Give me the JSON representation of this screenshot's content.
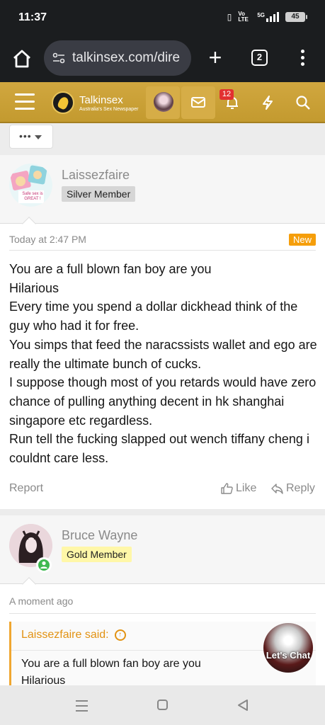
{
  "status": {
    "time": "11:37",
    "network_label": "Vo LTE",
    "signal_label": "5G",
    "battery": "45"
  },
  "browser": {
    "url": "talkinsex.com/dire",
    "tab_count": "2"
  },
  "site": {
    "name": "Talkinsex",
    "tagline": "Australia's Sex Newspaper",
    "notification_count": "12"
  },
  "posts": [
    {
      "author": "Laissezfaire",
      "role": "Silver Member",
      "avatar_caption": "Safe sex is GREAT !",
      "time": "Today at 2:47 PM",
      "new_label": "New",
      "lines": [
        "You are a full blown fan boy are you",
        "Hilarious",
        "Every time you spend a dollar dickhead think of the guy who had it for free.",
        "You simps that feed the naracssists wallet and ego are really the ultimate bunch of cucks.",
        "I suppose though most of you retards would have zero chance of pulling anything decent in hk shanghai singapore etc regardless.",
        "Run tell the fucking slapped out wench tiffany cheng i couldnt care less."
      ],
      "report_label": "Report",
      "like_label": "Like",
      "reply_label": "Reply"
    },
    {
      "author": "Bruce Wayne",
      "role": "Gold Member",
      "time": "A moment ago",
      "quote": {
        "header": "Laissezfaire said:",
        "text": "You are a full blown fan boy are you\nHilarious"
      }
    }
  ],
  "chat_widget": {
    "label": "Let's Chat"
  },
  "colors": {
    "header_gold": "#c9a035",
    "badge_new": "#f59e0b",
    "badge_gold": "#fff7a8",
    "quote_accent": "#e29212",
    "online": "#3fb950"
  }
}
